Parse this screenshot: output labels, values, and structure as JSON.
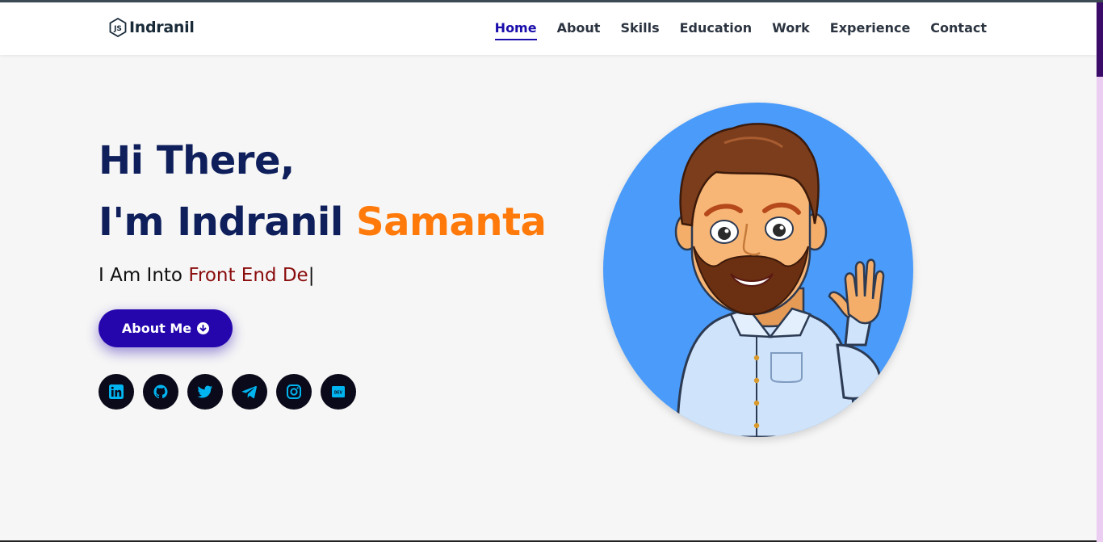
{
  "brand": {
    "name": "Indranil",
    "icon": "nodejs-icon"
  },
  "nav": {
    "items": [
      {
        "label": "Home",
        "active": true
      },
      {
        "label": "About",
        "active": false
      },
      {
        "label": "Skills",
        "active": false
      },
      {
        "label": "Education",
        "active": false
      },
      {
        "label": "Work",
        "active": false
      },
      {
        "label": "Experience",
        "active": false
      },
      {
        "label": "Contact",
        "active": false
      }
    ]
  },
  "hero": {
    "line1": "Hi There,",
    "line2_prefix": "I'm Indranil ",
    "line2_accent": "Samanta",
    "sub_prefix": "I Am Into ",
    "sub_typed": "Front End De",
    "cursor": "|",
    "button_label": "About Me",
    "button_icon": "arrow-circle-down-icon"
  },
  "social": [
    {
      "name": "linkedin",
      "icon": "linkedin-icon"
    },
    {
      "name": "github",
      "icon": "github-icon"
    },
    {
      "name": "twitter",
      "icon": "twitter-icon"
    },
    {
      "name": "telegram",
      "icon": "telegram-icon"
    },
    {
      "name": "instagram",
      "icon": "instagram-icon"
    },
    {
      "name": "dev",
      "icon": "dev-icon",
      "label": "DEV"
    }
  ],
  "colors": {
    "heading": "#0e1f5b",
    "accent": "#ff7a0a",
    "typed": "#8a0c0c",
    "button": "#2506ad",
    "nav_active": "#1a0dab",
    "avatar_bg": "#4a9bfa",
    "social_icon": "#00b4f0"
  }
}
